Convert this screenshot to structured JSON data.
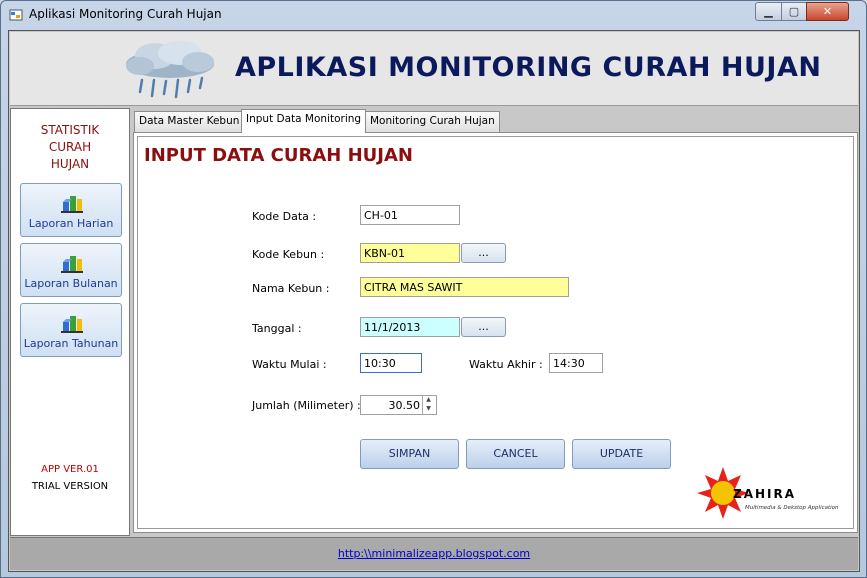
{
  "window": {
    "title": "Aplikasi Monitoring Curah Hujan",
    "icon": "app-window-icon",
    "controls": {
      "minimize": "minimize-icon",
      "maximize": "maximize-icon",
      "close": "close-icon"
    }
  },
  "header": {
    "title": "APLIKASI MONITORING CURAH HUJAN",
    "logo_icon": "rain-cloud-icon"
  },
  "sidebar": {
    "title": "STATISTIK CURAH HUJAN",
    "buttons": [
      {
        "label": "Laporan Harian",
        "icon": "chart-cube-icon"
      },
      {
        "label": "Laporan Bulanan",
        "icon": "chart-cube-icon"
      },
      {
        "label": "Laporan Tahunan",
        "icon": "chart-cube-icon"
      }
    ],
    "version": "APP VER.01",
    "edition": "TRIAL VERSION"
  },
  "tabs": [
    {
      "label": "Data Master Kebun",
      "active": false
    },
    {
      "label": "Input Data Monitoring",
      "active": true
    },
    {
      "label": "Monitoring Curah Hujan",
      "active": false
    }
  ],
  "form": {
    "heading": "INPUT DATA CURAH HUJAN",
    "kode_data": {
      "label": "Kode Data :",
      "value": "CH-01"
    },
    "kode_kebun": {
      "label": "Kode Kebun :",
      "value": "KBN-01",
      "browse": "..."
    },
    "nama_kebun": {
      "label": "Nama Kebun :",
      "value": "CITRA MAS SAWIT"
    },
    "tanggal": {
      "label": "Tanggal :",
      "value": "11/1/2013",
      "browse": "..."
    },
    "waktu_mulai": {
      "label": "Waktu Mulai :",
      "value": "10:30"
    },
    "waktu_akhir": {
      "label": "Waktu Akhir :",
      "value": "14:30"
    },
    "jumlah": {
      "label": "Jumlah (Milimeter) :",
      "value": "30.50"
    },
    "buttons": {
      "simpan": "SIMPAN",
      "cancel": "CANCEL",
      "update": "UPDATE"
    }
  },
  "brand": {
    "name": "ZAHIRA",
    "tagline": "Multimedia & Dekstop Application",
    "colors": {
      "sun": "#e8221a",
      "core": "#f4c400"
    }
  },
  "footer": {
    "link": "http:\\\\minimalizeapp.blogspot.com"
  },
  "colors": {
    "accent_red": "#8b0f0f",
    "title_blue": "#0b1a5c",
    "field_yellow": "#ffff99",
    "field_cyan": "#ccffff"
  }
}
